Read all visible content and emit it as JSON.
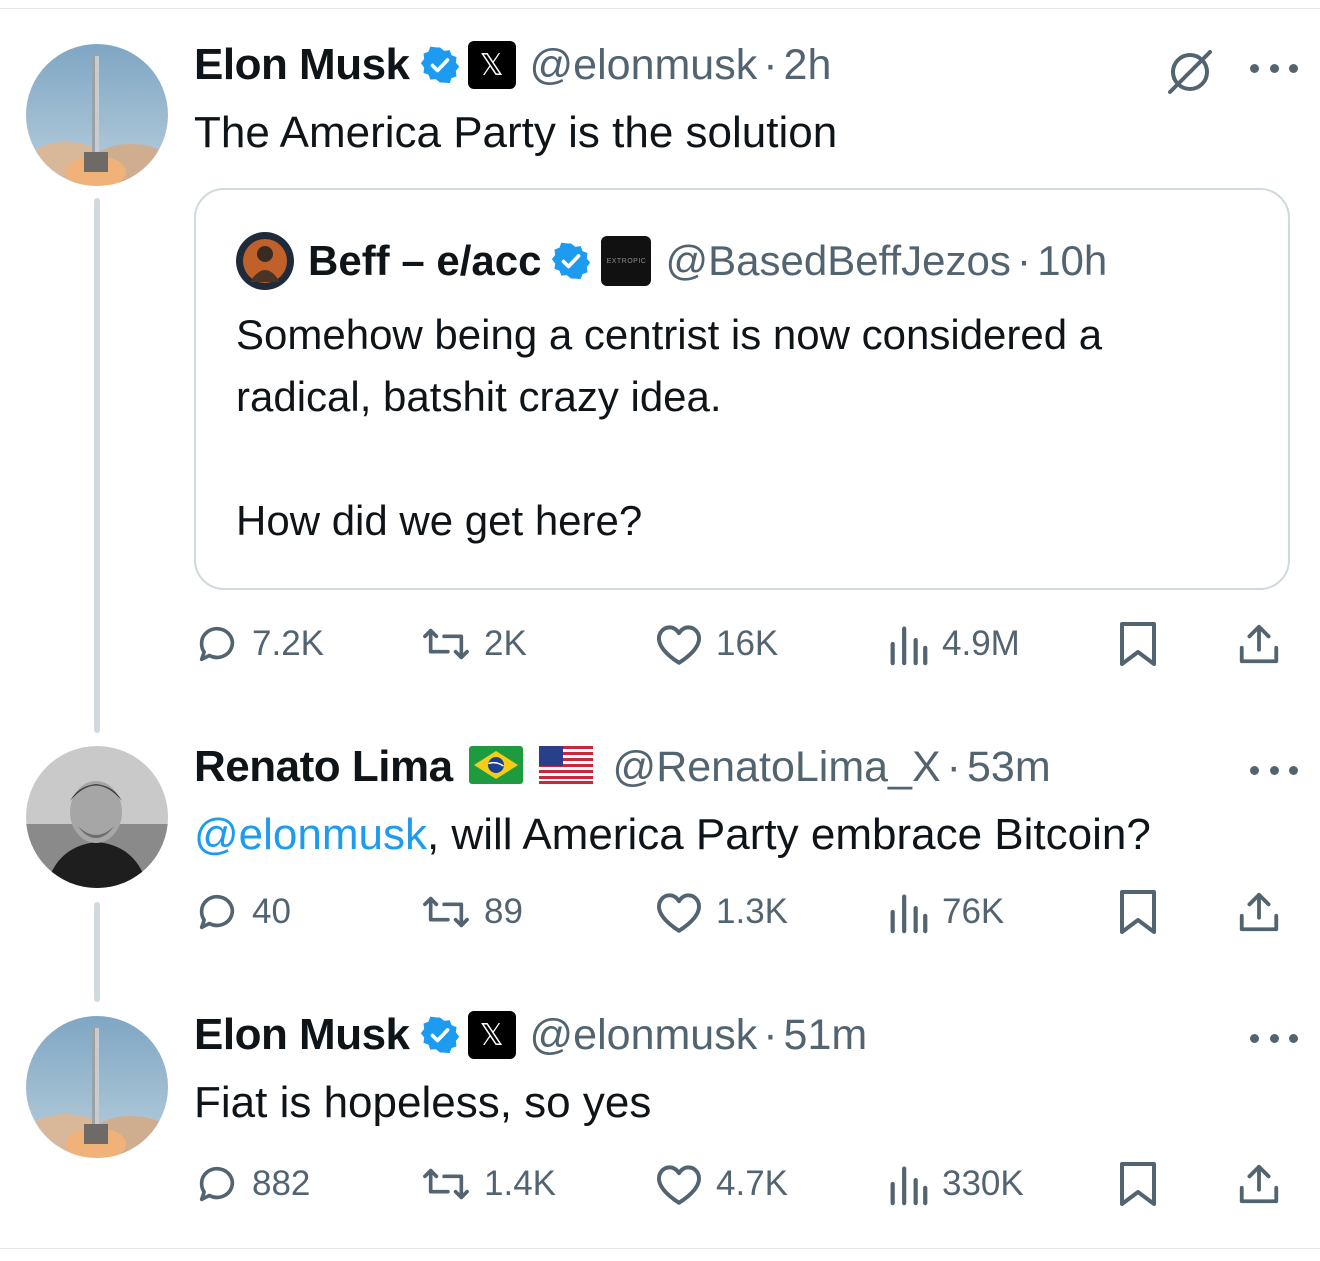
{
  "tweets": [
    {
      "name": "Elon Musk",
      "handle": "@elonmusk",
      "separator": "·",
      "time": "2h",
      "text": "The America Party is the solution",
      "quoted": {
        "name": "Beff – e/acc",
        "handle": "@BasedBeffJezos",
        "separator": "·",
        "time": "10h",
        "badge_text": "EXTROPIC",
        "lines": [
          "Somehow being a centrist is now considered a",
          "radical, batshit crazy idea.",
          "",
          "How did we get here?"
        ]
      },
      "stats": {
        "replies": "7.2K",
        "reposts": "2K",
        "likes": "16K",
        "views": "4.9M"
      }
    },
    {
      "name": "Renato Lima",
      "handle": "@RenatoLima_X",
      "separator": "·",
      "time": "53m",
      "mention": "@elonmusk",
      "text": ", will America Party embrace Bitcoin?",
      "stats": {
        "replies": "40",
        "reposts": "89",
        "likes": "1.3K",
        "views": "76K"
      }
    },
    {
      "name": "Elon Musk",
      "handle": "@elonmusk",
      "separator": "·",
      "time": "51m",
      "text": "Fiat is hopeless, so yes",
      "stats": {
        "replies": "882",
        "reposts": "1.4K",
        "likes": "4.7K",
        "views": "330K"
      }
    }
  ],
  "icons": {
    "reply": "speech-bubble-icon",
    "repost": "repost-arrows-icon",
    "like": "heart-icon",
    "views": "bar-chart-icon",
    "bookmark": "bookmark-icon",
    "share": "share-icon",
    "more": "more-dots-icon",
    "grok": "grok-slash-icon"
  },
  "colors": {
    "verified": "#1d9bf0",
    "mention": "#1d9bf0",
    "secondary_text": "#536471",
    "thread_line": "#cfd9de"
  }
}
